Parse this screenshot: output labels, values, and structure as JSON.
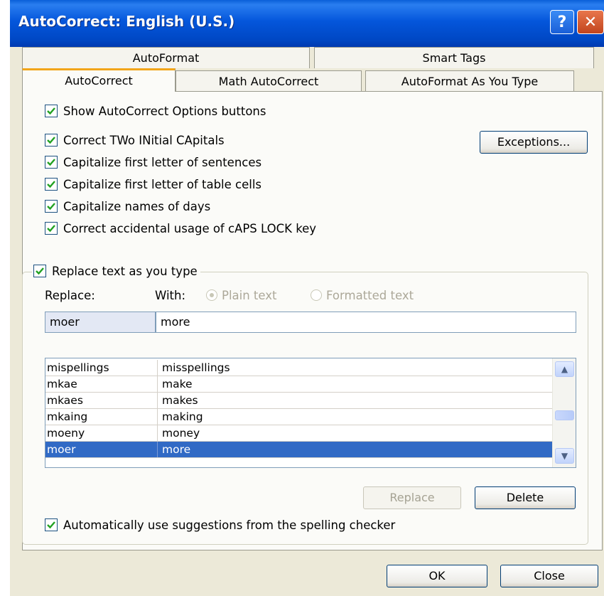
{
  "window": {
    "title": "AutoCorrect: English (U.S.)",
    "help_label": "?",
    "close_label": "✕"
  },
  "tabs": {
    "row1": [
      {
        "label": "AutoFormat"
      },
      {
        "label": "Smart Tags"
      }
    ],
    "row2": [
      {
        "label": "AutoCorrect",
        "active": true
      },
      {
        "label": "Math AutoCorrect"
      },
      {
        "label": "AutoFormat As You Type"
      }
    ]
  },
  "options": {
    "show_buttons": {
      "label": "Show AutoCorrect Options buttons",
      "checked": true
    },
    "correct_two_initial": {
      "label": "Correct TWo INitial CApitals",
      "checked": true
    },
    "capitalize_sentences": {
      "label": "Capitalize first letter of sentences",
      "checked": true
    },
    "capitalize_table_cells": {
      "label": "Capitalize first letter of table cells",
      "checked": true
    },
    "capitalize_days": {
      "label": "Capitalize names of days",
      "checked": true
    },
    "caps_lock": {
      "label": "Correct accidental usage of cAPS LOCK key",
      "checked": true
    },
    "exceptions_button": "Exceptions..."
  },
  "replace_group": {
    "label": "Replace text as you type",
    "checked": true,
    "replace_label": "Replace:",
    "with_label": "With:",
    "plain_text_label": "Plain text",
    "formatted_text_label": "Formatted text",
    "replace_value": "moer",
    "with_value": "more",
    "entries": [
      {
        "from": "mispellings",
        "to": "misspellings"
      },
      {
        "from": "mkae",
        "to": "make"
      },
      {
        "from": "mkaes",
        "to": "makes"
      },
      {
        "from": "mkaing",
        "to": "making"
      },
      {
        "from": "moeny",
        "to": "money"
      },
      {
        "from": "moer",
        "to": "more",
        "selected": true
      }
    ],
    "replace_button": "Replace",
    "delete_button": "Delete",
    "suggestions": {
      "label": "Automatically use suggestions from the spelling checker",
      "checked": true
    }
  },
  "footer": {
    "ok_button": "OK",
    "close_button": "Close"
  }
}
